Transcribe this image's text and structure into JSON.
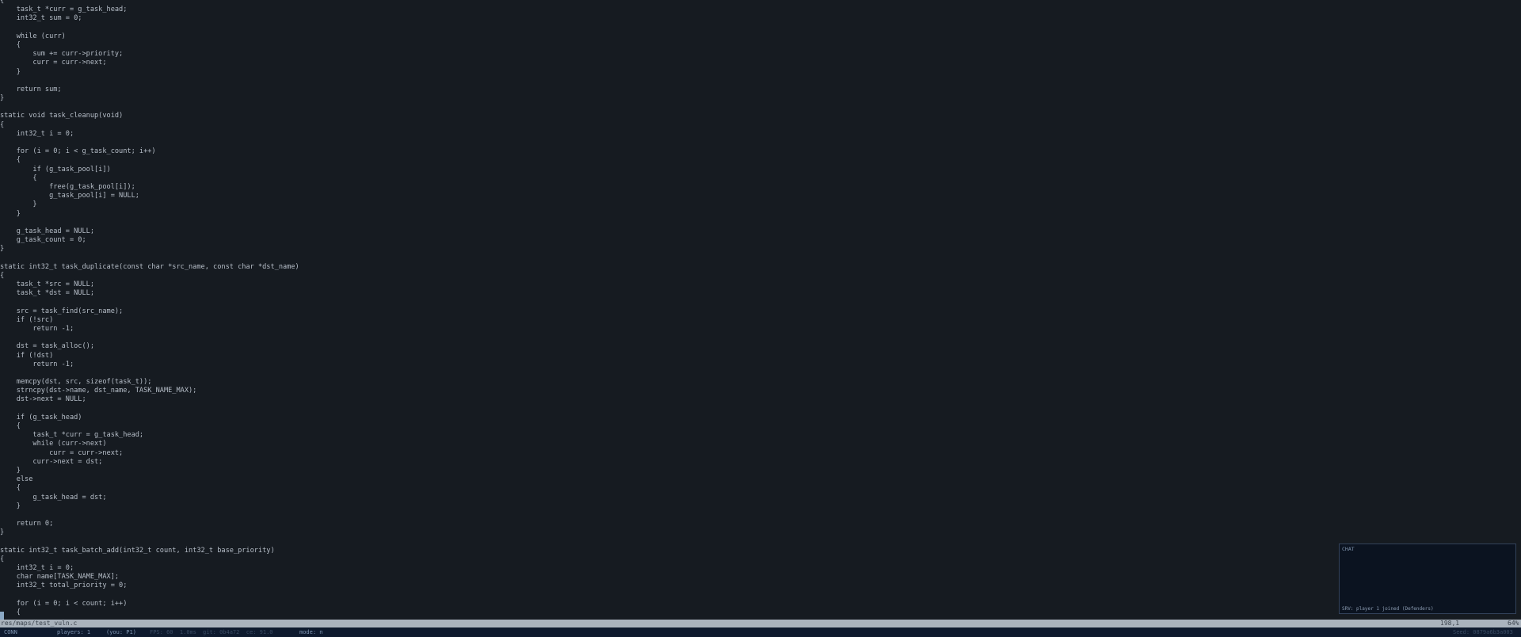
{
  "editor": {
    "lines": [
      "{",
      "    task_t *curr = g_task_head;",
      "    int32_t sum = 0;",
      "",
      "    while (curr)",
      "    {",
      "        sum += curr->priority;",
      "        curr = curr->next;",
      "    }",
      "",
      "    return sum;",
      "}",
      "",
      "static void task_cleanup(void)",
      "{",
      "    int32_t i = 0;",
      "",
      "    for (i = 0; i < g_task_count; i++)",
      "    {",
      "        if (g_task_pool[i])",
      "        {",
      "            free(g_task_pool[i]);",
      "            g_task_pool[i] = NULL;",
      "        }",
      "    }",
      "",
      "    g_task_head = NULL;",
      "    g_task_count = 0;",
      "}",
      "",
      "static int32_t task_duplicate(const char *src_name, const char *dst_name)",
      "{",
      "    task_t *src = NULL;",
      "    task_t *dst = NULL;",
      "",
      "    src = task_find(src_name);",
      "    if (!src)",
      "        return -1;",
      "",
      "    dst = task_alloc();",
      "    if (!dst)",
      "        return -1;",
      "",
      "    memcpy(dst, src, sizeof(task_t));",
      "    strncpy(dst->name, dst_name, TASK_NAME_MAX);",
      "    dst->next = NULL;",
      "",
      "    if (g_task_head)",
      "    {",
      "        task_t *curr = g_task_head;",
      "        while (curr->next)",
      "            curr = curr->next;",
      "        curr->next = dst;",
      "    }",
      "    else",
      "    {",
      "        g_task_head = dst;",
      "    }",
      "",
      "    return 0;",
      "}",
      "",
      "static int32_t task_batch_add(int32_t count, int32_t base_priority)",
      "{",
      "    int32_t i = 0;",
      "    char name[TASK_NAME_MAX];",
      "    int32_t total_priority = 0;",
      "",
      "    for (i = 0; i < count; i++)",
      "    {"
    ]
  },
  "statusline": {
    "file": "res/maps/test_vuln.c",
    "position": "198,1",
    "percent": "64%"
  },
  "bottombar": {
    "mode_left": "CONN",
    "players": "players: 1",
    "you": "(you: P1)",
    "fps": "FPS: 60  1.0ms",
    "git": "git: 0b4a72  ce: 91.0",
    "mode": "mode: n",
    "right": "Seed: 0879a6b3a003"
  },
  "chat": {
    "title": "CHAT",
    "messages": [
      "SRV: player 1 joined (Defenders)"
    ]
  },
  "colors": {
    "background": "#161b21",
    "text": "#b6bec8",
    "statusline": "#aab3bd",
    "bottombar": "#0e1a2e"
  }
}
